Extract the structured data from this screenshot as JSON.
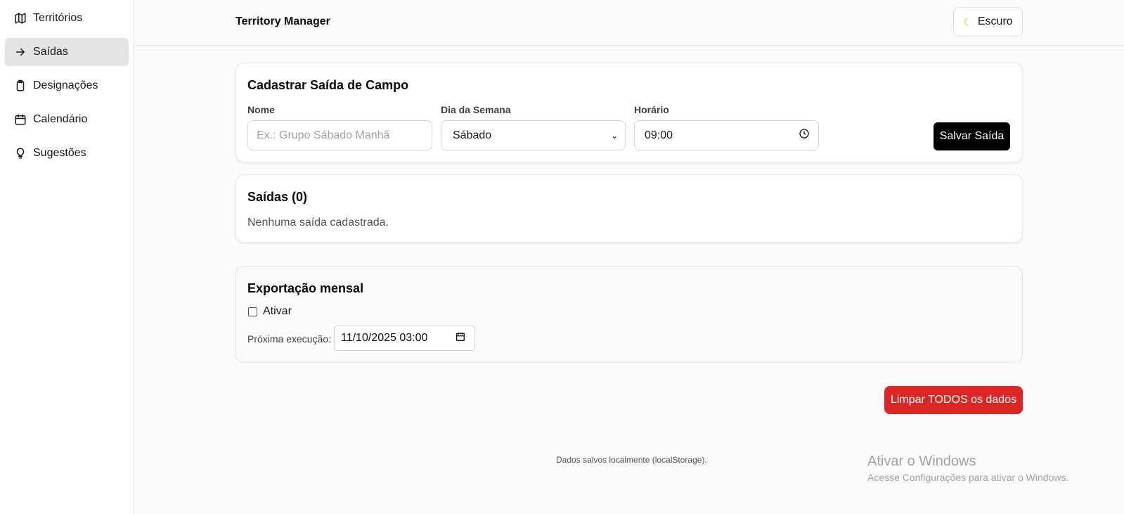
{
  "sidebar": {
    "items": [
      {
        "label": "Territórios",
        "icon": "map-icon",
        "active": false
      },
      {
        "label": "Saídas",
        "icon": "arrow-right-icon",
        "active": true
      },
      {
        "label": "Designações",
        "icon": "clipboard-icon",
        "active": false
      },
      {
        "label": "Calendário",
        "icon": "calendar-icon",
        "active": false
      },
      {
        "label": "Sugestões",
        "icon": "lightbulb-icon",
        "active": false
      }
    ]
  },
  "header": {
    "title": "Territory Manager",
    "theme_button": "Escuro",
    "theme_icon": "moon-icon"
  },
  "form": {
    "title": "Cadastrar Saída de Campo",
    "name_label": "Nome",
    "name_placeholder": "Ex.: Grupo Sábado Manhã",
    "name_value": "",
    "day_label": "Dia da Semana",
    "day_value": "Sábado",
    "time_label": "Horário",
    "time_value": "09:00",
    "save_button": "Salvar Saída"
  },
  "list": {
    "title": "Saídas (0)",
    "empty_message": "Nenhuma saída cadastrada."
  },
  "export": {
    "title": "Exportação mensal",
    "activate_label": "Ativar",
    "activate_checked": false,
    "next_label": "Próxima execução:",
    "next_value": "11/10/2025 03:00"
  },
  "danger_button": "Limpar TODOS os dados",
  "footer": "Dados salvos localmente (localStorage).",
  "watermark": {
    "title": "Ativar o Windows",
    "subtitle": "Acesse Configurações para ativar o Windows."
  },
  "colors": {
    "accent": "#000000",
    "danger": "#dc2626",
    "active_nav": "#e4e4e7"
  }
}
